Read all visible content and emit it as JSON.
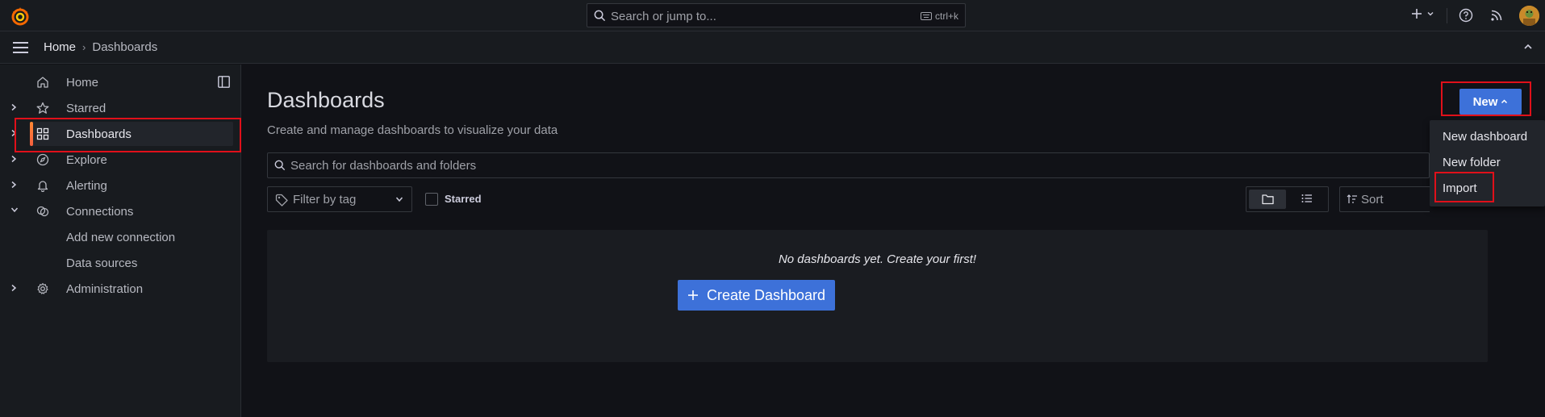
{
  "topbar": {
    "search_placeholder": "Search or jump to...",
    "shortcut": "ctrl+k",
    "add_icon": "plus-icon",
    "help_icon": "help-icon",
    "news_icon": "rss-icon"
  },
  "breadcrumb": {
    "home": "Home",
    "separator": "›",
    "current": "Dashboards"
  },
  "sidebar": {
    "items": [
      {
        "label": "Home",
        "icon": "home-icon",
        "expandable": false
      },
      {
        "label": "Starred",
        "icon": "star-icon",
        "expandable": true
      },
      {
        "label": "Dashboards",
        "icon": "apps-icon",
        "expandable": true,
        "active": true
      },
      {
        "label": "Explore",
        "icon": "compass-icon",
        "expandable": true
      },
      {
        "label": "Alerting",
        "icon": "bell-icon",
        "expandable": true
      },
      {
        "label": "Connections",
        "icon": "connections-icon",
        "expandable": true,
        "expanded": true
      },
      {
        "label": "Add new connection",
        "sub": true
      },
      {
        "label": "Data sources",
        "sub": true
      },
      {
        "label": "Administration",
        "icon": "cog-icon",
        "expandable": true
      }
    ]
  },
  "main": {
    "title": "Dashboards",
    "subtitle": "Create and manage dashboards to visualize your data",
    "new_button": "New",
    "new_menu": [
      "New dashboard",
      "New folder",
      "Import"
    ],
    "search_placeholder": "Search for dashboards and folders",
    "tag_filter_placeholder": "Filter by tag",
    "starred_label": "Starred",
    "sort_placeholder": "Sort",
    "empty_message": "No dashboards yet. Create your first!",
    "create_button": "Create Dashboard"
  },
  "colors": {
    "background": "#111217",
    "panel": "#181b1f",
    "primary": "#3d71d9",
    "active_accent": "#f55f3e",
    "annotation": "#e0101a"
  }
}
